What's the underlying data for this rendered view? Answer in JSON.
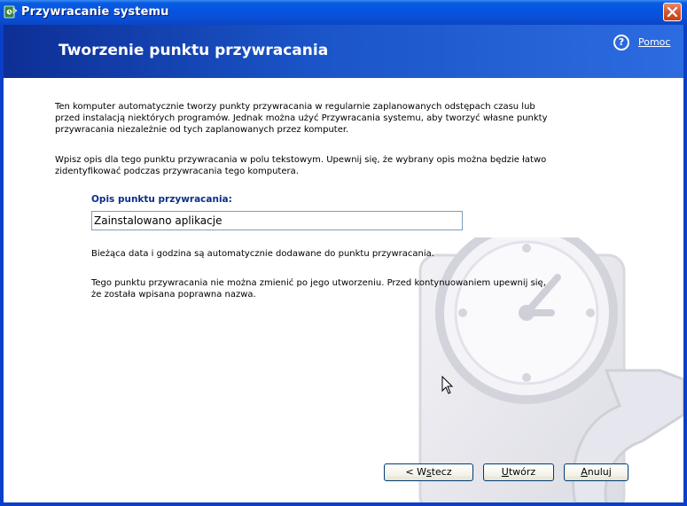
{
  "window": {
    "title": "Przywracanie systemu"
  },
  "header": {
    "title": "Tworzenie punktu przywracania",
    "help_link": "Pomoc",
    "help_icon": "help-circle-icon"
  },
  "content": {
    "intro_paragraph": [
      "Ten komputer automatycznie tworzy punkty przywracania w regularnie zaplanowanych odstępach czasu lub",
      "przed instalacją niektórych programów. Jednak można użyć Przywracania systemu, aby tworzyć własne punkty",
      "przywracania niezależnie od tych zaplanowanych przez komputer."
    ],
    "instruction_paragraph": [
      "Wpisz opis dla tego punktu przywracania w polu tekstowym. Upewnij się, że wybrany opis można będzie łatwo",
      "zidentyfikować podczas przywracania tego komputera."
    ],
    "field_label": "Opis punktu przywracania:",
    "field_value": "Zainstalowano aplikacje",
    "note_datetime": "Bieżąca data i godzina są automatycznie dodawane do punktu przywracania.",
    "note_immutable": [
      "Tego punktu przywracania nie można zmienić po jego utworzeniu. Przed kontynuowaniem upewnij się,",
      "że została wpisana poprawna nazwa."
    ]
  },
  "buttons": {
    "back": {
      "prefix": "< W",
      "accel": "s",
      "suffix": "tecz"
    },
    "create": {
      "prefix": "",
      "accel": "U",
      "suffix": "twórz"
    },
    "cancel": {
      "prefix": "",
      "accel": "A",
      "suffix": "nuluj"
    }
  },
  "colors": {
    "titlebar": "#0554e2",
    "header_gradient_start": "#0d2f95",
    "header_gradient_end": "#2c6ce0",
    "field_label": "#0b2f8a",
    "close_button": "#d65a34"
  }
}
